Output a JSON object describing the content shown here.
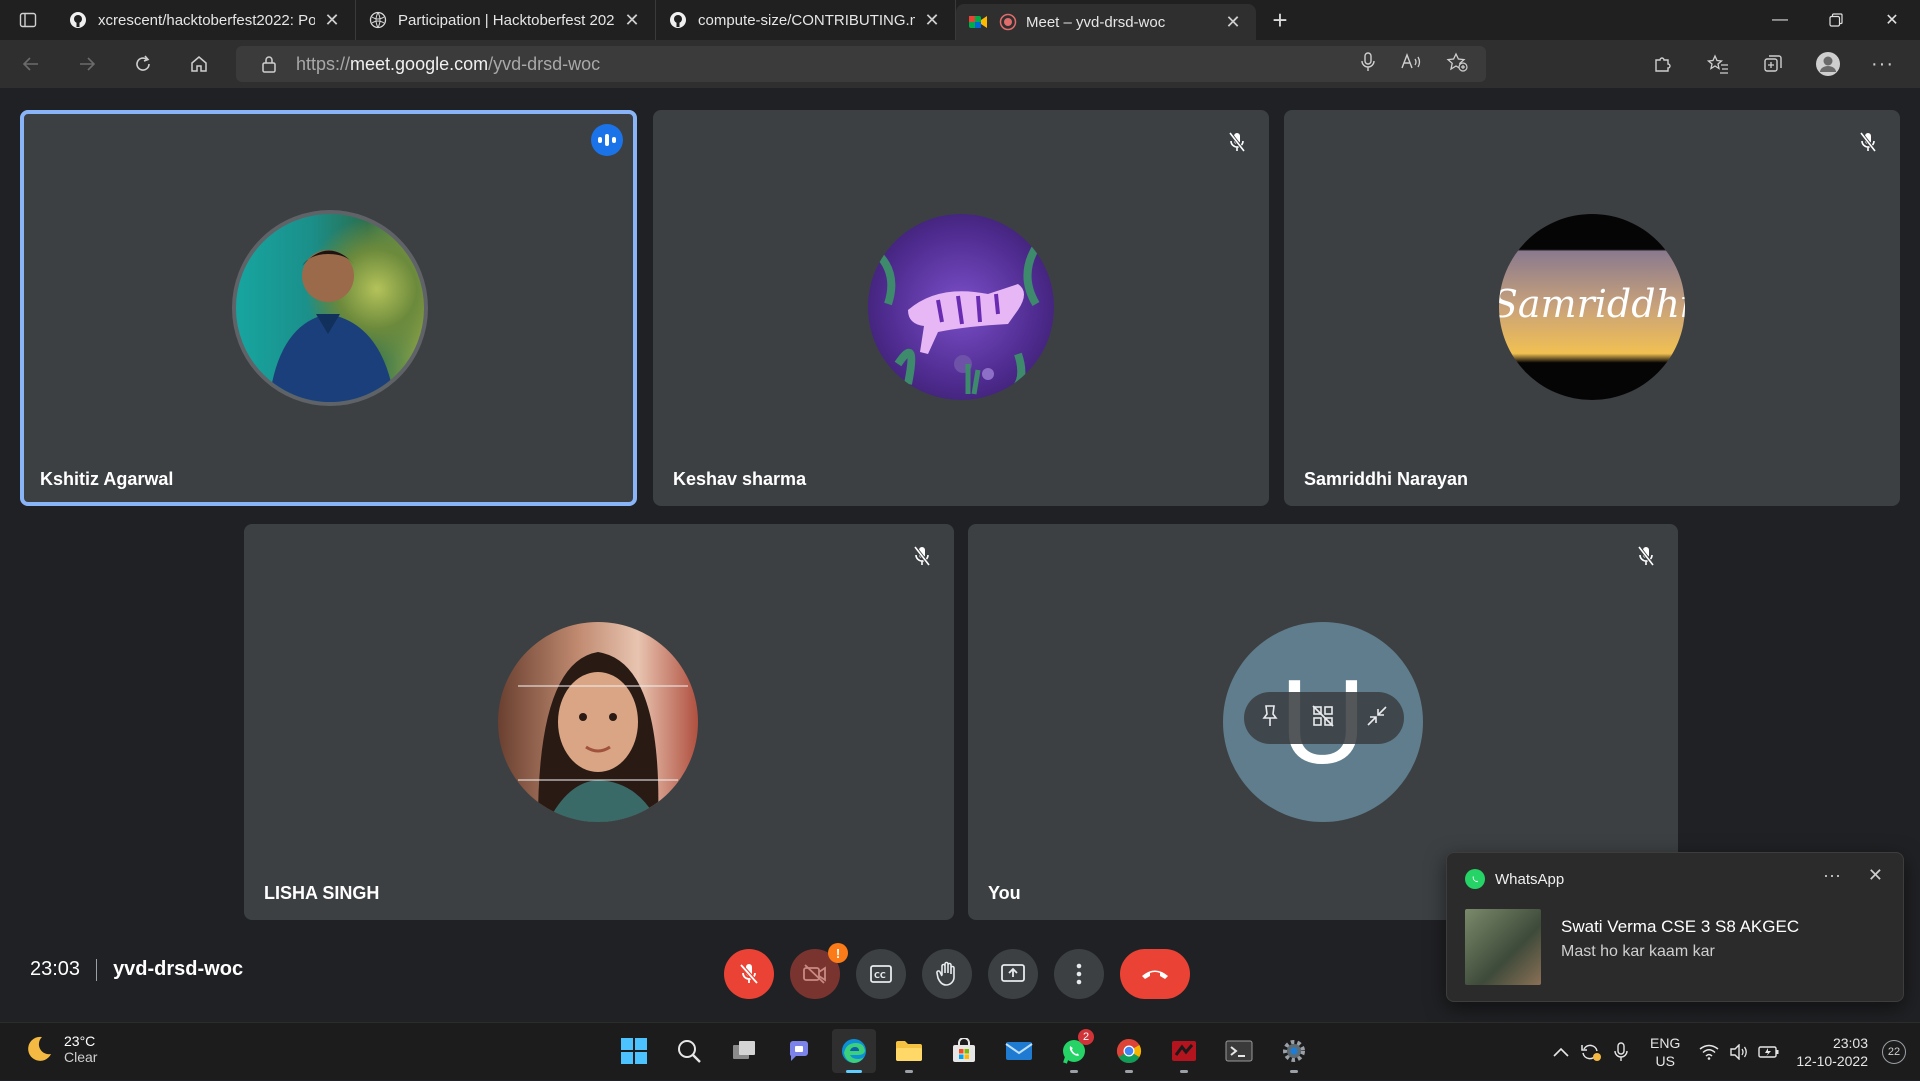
{
  "browser": {
    "tabs": [
      {
        "title": "xcrescent/hacktoberfest2022: Po",
        "favicon": "github-icon",
        "active": false
      },
      {
        "title": "Participation | Hacktoberfest 202",
        "favicon": "hacktoberfest-globe-icon",
        "active": false
      },
      {
        "title": "compute-size/CONTRIBUTING.m",
        "favicon": "github-icon",
        "active": false
      },
      {
        "title": "Meet – yvd-drsd-woc",
        "favicon": "google-meet-icon",
        "active": true
      }
    ],
    "url_prefix": "https://",
    "url_host": "meet.google.com",
    "url_path": "/yvd-drsd-woc"
  },
  "meet": {
    "participants": [
      {
        "name": "Kshitiz Agarwal",
        "speaking": true,
        "muted": false
      },
      {
        "name": "Keshav sharma",
        "speaking": false,
        "muted": true
      },
      {
        "name": "Samriddhi Narayan",
        "speaking": false,
        "muted": true,
        "avatar_text": "Samriddhi"
      },
      {
        "name": "LISHA SINGH",
        "speaking": false,
        "muted": true
      },
      {
        "name": "You",
        "speaking": false,
        "muted": true,
        "avatar_letter": "U"
      }
    ],
    "time": "23:03",
    "meeting_code": "yvd-drsd-woc",
    "camera_badge": "!",
    "accent_color": "#8ab4f8",
    "hangup_color": "#ea4335"
  },
  "toast": {
    "app": "WhatsApp",
    "more": "···",
    "close": "✕",
    "sender": "Swati Verma CSE 3 S8 AKGEC",
    "message": "Mast ho kar kaam kar"
  },
  "taskbar": {
    "temperature": "23°C",
    "weather": "Clear",
    "whatsapp_badge": "2",
    "lang_line1": "ENG",
    "lang_line2": "US",
    "time": "23:03",
    "date": "12-10-2022",
    "notification_count": "22"
  }
}
